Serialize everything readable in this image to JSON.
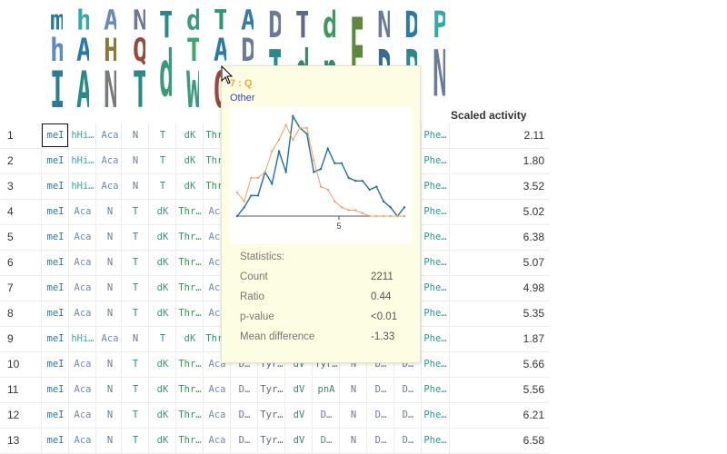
{
  "activity_header": "Scaled activity",
  "logo_columns": [
    {
      "letters": [
        "meI",
        "hh",
        "II"
      ],
      "colors": [
        "#2a7a9a",
        "#5a8ac8",
        "#2a7a9a"
      ]
    },
    {
      "letters": [
        "hHi",
        "Aca",
        "Ac"
      ],
      "colors": [
        "#3aa8a8",
        "#2a7aa8",
        "#2a8a8a"
      ]
    },
    {
      "letters": [
        "Aca",
        "Hyp",
        "N"
      ],
      "colors": [
        "#6b8ab8",
        "#8a7a3a",
        "#7a7a7a"
      ]
    },
    {
      "letters": [
        "N",
        "Q",
        "T"
      ],
      "colors": [
        "#6a7a9a",
        "#9a4a3a",
        "#2a8a8a"
      ]
    },
    {
      "letters": [
        "T",
        "dK"
      ],
      "colors": [
        "#2a8a8a",
        "#3a9a7a"
      ]
    },
    {
      "letters": [
        "dK",
        "Thr",
        "W"
      ],
      "colors": [
        "#3a9a7a",
        "#3aa86a",
        "#3a9a7a"
      ]
    },
    {
      "letters": [
        "Thr",
        "Aca",
        "Q"
      ],
      "colors": [
        "#2a9a6a",
        "#2a7aa8",
        "#9a4a3a"
      ]
    },
    {
      "letters": [
        "Aca",
        "D",
        "C"
      ],
      "colors": [
        "#3a7aa8",
        "#6a7a9a",
        "#9a9a3a"
      ]
    },
    {
      "letters": [
        "D",
        "T"
      ],
      "colors": [
        "#6a7a9a",
        "#2a8a8a"
      ]
    },
    {
      "letters": [
        "Tyr",
        "dV"
      ],
      "colors": [
        "#5a6a8a",
        "#3a8a6a"
      ]
    },
    {
      "letters": [
        "dV",
        "pnA"
      ],
      "colors": [
        "#3a9a5a",
        "#3a8a6a"
      ]
    },
    {
      "letters": [
        "E"
      ],
      "colors": [
        "#5a8a3a"
      ]
    },
    {
      "letters": [
        "N",
        "D"
      ],
      "colors": [
        "#6a7a9a",
        "#3a6a9a"
      ]
    },
    {
      "letters": [
        "D",
        "Phe"
      ],
      "colors": [
        "#2a7aa8",
        "#2a8a8a"
      ]
    },
    {
      "letters": [
        "Phe",
        "N"
      ],
      "colors": [
        "#3aa8a8",
        "#6a7a9a"
      ]
    }
  ],
  "rows": [
    {
      "num": "1",
      "cells": [
        "meI",
        "hHi…",
        "Aca",
        "N",
        "T",
        "dK",
        "Thr…",
        "",
        "",
        "",
        "",
        "",
        "",
        "",
        "Phe…"
      ],
      "activity": "2.11"
    },
    {
      "num": "2",
      "cells": [
        "meI",
        "hHi…",
        "Aca",
        "N",
        "T",
        "dK",
        "Thr…",
        "",
        "",
        "",
        "",
        "",
        "",
        "",
        "Phe…"
      ],
      "activity": "1.80"
    },
    {
      "num": "3",
      "cells": [
        "meI",
        "hHi…",
        "Aca",
        "N",
        "T",
        "dK",
        "Thr…",
        "",
        "",
        "",
        "",
        "",
        "",
        "",
        "Phe…"
      ],
      "activity": "3.52"
    },
    {
      "num": "4",
      "cells": [
        "meI",
        "Aca",
        "N",
        "T",
        "dK",
        "Thr…",
        "Aca",
        "",
        "",
        "",
        "",
        "",
        "",
        "",
        "Phe…"
      ],
      "activity": "5.02"
    },
    {
      "num": "5",
      "cells": [
        "meI",
        "Aca",
        "N",
        "T",
        "dK",
        "Thr…",
        "Aca",
        "",
        "",
        "",
        "",
        "",
        "",
        "",
        "Phe…"
      ],
      "activity": "6.38"
    },
    {
      "num": "6",
      "cells": [
        "meI",
        "Aca",
        "N",
        "T",
        "dK",
        "Thr…",
        "Aca",
        "",
        "",
        "",
        "",
        "",
        "",
        "",
        "Phe…"
      ],
      "activity": "5.07"
    },
    {
      "num": "7",
      "cells": [
        "meI",
        "Aca",
        "N",
        "T",
        "dK",
        "Thr…",
        "Aca",
        "",
        "",
        "",
        "",
        "",
        "",
        "",
        "Phe…"
      ],
      "activity": "4.98"
    },
    {
      "num": "8",
      "cells": [
        "meI",
        "Aca",
        "N",
        "T",
        "dK",
        "Thr…",
        "Aca",
        "",
        "",
        "",
        "",
        "",
        "",
        "",
        "Phe…"
      ],
      "activity": "5.35"
    },
    {
      "num": "9",
      "cells": [
        "meI",
        "hHi…",
        "Aca",
        "N",
        "T",
        "dK",
        "Thr…",
        "",
        "",
        "",
        "",
        "",
        "",
        "",
        "Phe…"
      ],
      "activity": "1.87"
    },
    {
      "num": "10",
      "cells": [
        "meI",
        "Aca",
        "N",
        "T",
        "dK",
        "Thr…",
        "Aca",
        "D…",
        "Tyr…",
        "dV",
        "Tyr…",
        "N",
        "D…",
        "D…",
        "Phe…"
      ],
      "activity": "5.66"
    },
    {
      "num": "11",
      "cells": [
        "meI",
        "Aca",
        "N",
        "T",
        "dK",
        "Thr…",
        "Aca",
        "D…",
        "Tyr…",
        "dV",
        "pnA",
        "N",
        "D…",
        "D…",
        "Phe…"
      ],
      "activity": "5.56"
    },
    {
      "num": "12",
      "cells": [
        "meI",
        "Aca",
        "N",
        "T",
        "dK",
        "Thr…",
        "Aca",
        "D…",
        "Tyr…",
        "dV",
        "D…",
        "N",
        "D…",
        "D…",
        "Phe…"
      ],
      "activity": "6.21"
    },
    {
      "num": "13",
      "cells": [
        "meI",
        "Aca",
        "N",
        "T",
        "dK",
        "Thr…",
        "Aca",
        "D…",
        "Tyr…",
        "dV",
        "D…",
        "N",
        "D…",
        "D…",
        "Phe…"
      ],
      "activity": "6.58"
    }
  ],
  "token_colors": {
    "meI": "#2a7a9a",
    "hHi…": "#3aa8a8",
    "Aca": "#6b8ab8",
    "N": "#6a7a9a",
    "T": "#2a8a8a",
    "dK": "#3a9a7a",
    "Thr…": "#2a9a4a",
    "D…": "#6a7a9a",
    "Tyr…": "#5a6a8a",
    "dV": "#3a8a6a",
    "pnA": "#3a8a6a",
    "Phe…": "#2a9a9a"
  },
  "tooltip": {
    "title": "7 : Q",
    "subtitle": "Other",
    "stats_header": "Statistics:",
    "stats": [
      {
        "label": "Count",
        "value": "2211"
      },
      {
        "label": "Ratio",
        "value": "0.44"
      },
      {
        "label": "p-value",
        "value": "<0.01"
      },
      {
        "label": "Mean difference",
        "value": "-1.33"
      }
    ],
    "colors": {
      "series_a": "#1f6fa0",
      "series_b": "#f0a060"
    }
  },
  "chart_data": {
    "type": "line",
    "x": [
      0,
      1,
      2,
      3,
      4,
      5,
      6,
      7,
      8,
      9,
      10,
      11,
      12,
      13,
      14,
      15,
      16,
      17
    ],
    "xticks": [
      "5"
    ],
    "series": [
      {
        "values": [
          0,
          3,
          7,
          7,
          15,
          11,
          22,
          15,
          34,
          30,
          28,
          15,
          16,
          23,
          18,
          18,
          13,
          12,
          12,
          9,
          10,
          5,
          3,
          0,
          3
        ]
      },
      {
        "values": [
          8,
          5,
          13,
          13,
          15,
          22,
          26,
          31,
          26,
          30,
          30,
          19,
          10,
          9,
          5,
          3,
          2,
          2,
          1,
          0,
          0,
          0,
          0,
          0,
          0
        ]
      }
    ]
  }
}
